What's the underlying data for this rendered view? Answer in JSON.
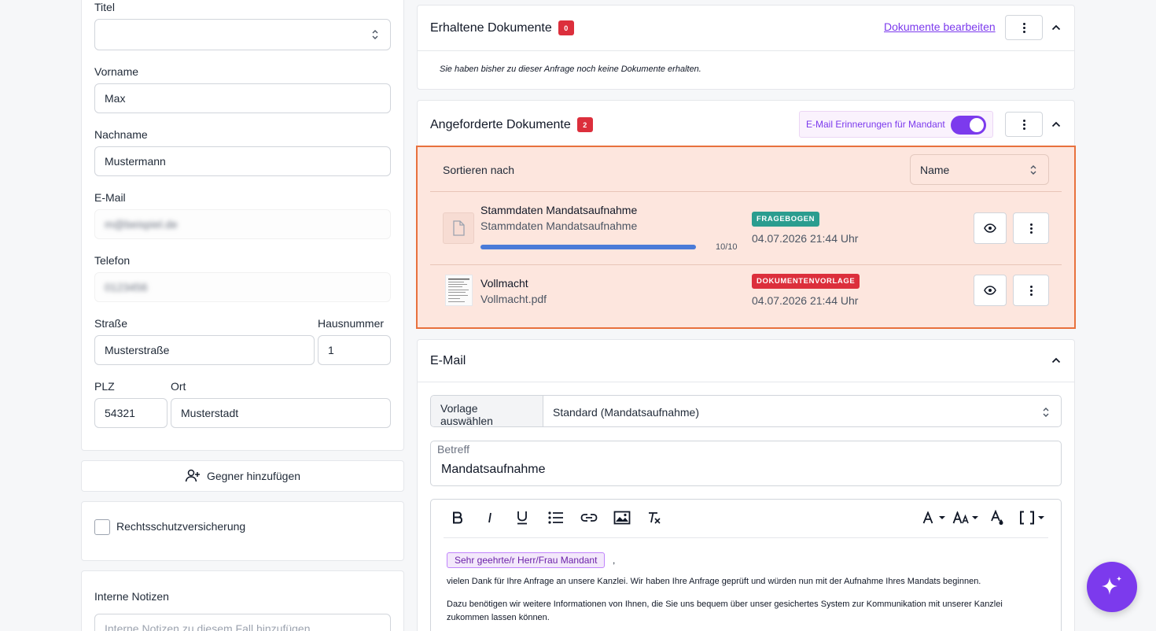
{
  "form": {
    "titel_label": "Titel",
    "titel_value": "",
    "vorname_label": "Vorname",
    "vorname_value": "Max",
    "nachname_label": "Nachname",
    "nachname_value": "Mustermann",
    "email_label": "E-Mail",
    "email_value": "m@beispiel.de",
    "telefon_label": "Telefon",
    "telefon_value": "0123456",
    "strasse_label": "Straße",
    "strasse_value": "Musterstraße",
    "hausnummer_label": "Hausnummer",
    "hausnummer_value": "1",
    "plz_label": "PLZ",
    "plz_value": "54321",
    "ort_label": "Ort",
    "ort_value": "Musterstadt"
  },
  "gegner_button": "Gegner hinzufügen",
  "rechtsschutz_label": "Rechtsschutzversicherung",
  "notizen": {
    "label": "Interne Notizen",
    "placeholder": "Interne Notizen zu diesem Fall hinzufügen"
  },
  "erhaltene": {
    "title": "Erhaltene Dokumente",
    "count": "0",
    "edit_link": "Dokumente bearbeiten",
    "empty_text": "Sie haben bisher zu dieser Anfrage noch keine Dokumente erhalten."
  },
  "angeforderte": {
    "title": "Angeforderte Dokumente",
    "count": "2",
    "reminder_label": "E-Mail Erinnerungen für Mandant",
    "reminder_on": true,
    "sort_label": "Sortieren nach",
    "sort_value": "Name",
    "documents": [
      {
        "title": "Stammdaten Mandatsaufnahme",
        "subtitle": "Stammdaten Mandatsaufnahme",
        "progress_text": "10/10",
        "progress": 1.0,
        "tag": "FRAGEBOGEN",
        "tag_color": "#2a9d8f",
        "date": "04.07.2026 21:44 Uhr"
      },
      {
        "title": "Vollmacht",
        "subtitle": "Vollmacht.pdf",
        "tag": "DOKUMENTENVORLAGE",
        "tag_color": "#dc2f3c",
        "date": "04.07.2026 21:44 Uhr"
      }
    ]
  },
  "email": {
    "title": "E-Mail",
    "template_label": "Vorlage auswählen",
    "template_value": "Standard (Mandatsaufnahme)",
    "subject_label": "Betreff",
    "subject_value": "Mandatsaufnahme",
    "greeting_placeholder": "Sehr geehrte/r Herr/Frau Mandant",
    "greeting_suffix": ",",
    "body_line1": "vielen Dank für Ihre Anfrage an unsere Kanzlei. Wir haben Ihre Anfrage geprüft und würden nun mit der Aufnahme Ihres Mandats beginnen.",
    "body_line2": "Dazu benötigen wir weitere Informationen von Ihnen, die Sie uns bequem über unser gesichertes System zur Kommunikation mit unserer Kanzlei zukommen lassen können."
  },
  "colors": {
    "accent": "#7c3aed",
    "highlight_border": "#e8713d",
    "highlight_bg": "#fde6de",
    "progress": "#4a7bd8"
  }
}
